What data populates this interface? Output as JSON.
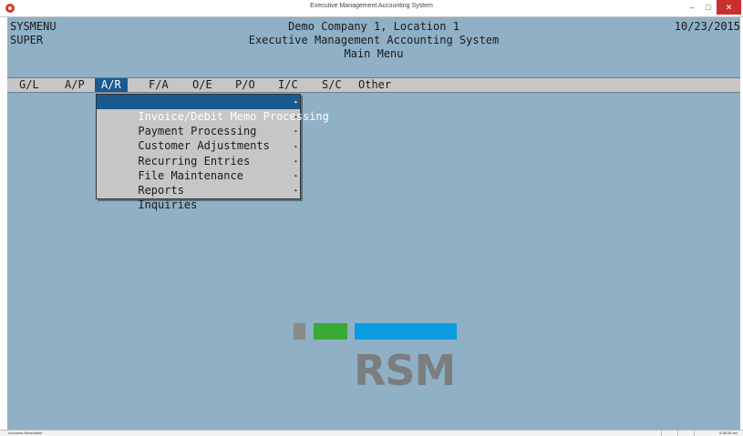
{
  "window": {
    "title": "Executive Management Accounting System"
  },
  "header": {
    "menu_name": "SYSMENU",
    "user": "SUPER",
    "company": "Demo Company 1, Location 1",
    "system": "Executive Management Accounting System",
    "screen": "Main Menu",
    "date": "10/23/2015"
  },
  "menubar": {
    "items": [
      {
        "label": "G/L"
      },
      {
        "label": "A/P"
      },
      {
        "label": "A/R"
      },
      {
        "label": "F/A"
      },
      {
        "label": "O/E"
      },
      {
        "label": "P/O"
      },
      {
        "label": "I/C"
      },
      {
        "label": "S/C"
      },
      {
        "label": "Other"
      }
    ],
    "active_index": 2
  },
  "dropdown": {
    "items": [
      {
        "label": "Invoice/Debit Memo Processing"
      },
      {
        "label": "Payment Processing"
      },
      {
        "label": "Customer Adjustments"
      },
      {
        "label": "Recurring Entries"
      },
      {
        "label": "File Maintenance"
      },
      {
        "label": "Reports"
      },
      {
        "label": "Inquiries"
      }
    ],
    "selected_index": 0,
    "submenu_icon": "triangle-right-icon"
  },
  "logo": {
    "text": "RSM",
    "colors": [
      "#8a8a8a",
      "#3aa935",
      "#0a9be0"
    ]
  },
  "statusbar": {
    "left": "Accounts Receivable",
    "right": "9:38:35 am"
  },
  "colors": {
    "screen_bg": "#8fb0c5",
    "highlight": "#1b5a8e",
    "menu_bg": "#c6c6c6"
  }
}
